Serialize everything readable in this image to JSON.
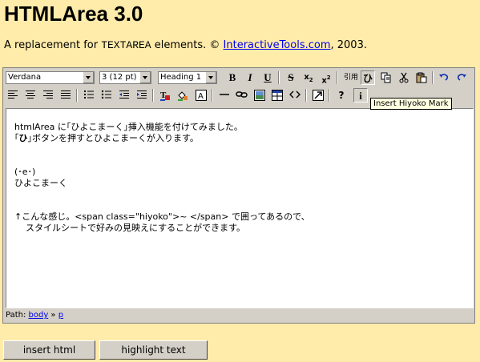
{
  "page": {
    "title": "HTMLArea 3.0",
    "subtitle_prefix": "A replacement for ",
    "subtitle_code": "TEXTAREA",
    "subtitle_middle": " elements. © ",
    "subtitle_link": "InteractiveTools.com",
    "subtitle_suffix": ", 2003."
  },
  "toolbar": {
    "font_name": "Verdana",
    "font_size": "3 (12 pt)",
    "format_block": "Heading 1",
    "bold": "B",
    "italic": "I",
    "underline": "U",
    "strikethrough": "S",
    "subscript": "x",
    "subscript_mark": "2",
    "superscript": "x",
    "superscript_mark": "2",
    "quote_label": "引用",
    "hiyoko_label": "ひ",
    "help_label": "?",
    "about_label": "i",
    "tooltip": "Insert Hiyoko Mark"
  },
  "content": {
    "line1": "htmlArea に｢ひよこまーく｣挿入機能を付けてみました。",
    "line2_open": "｢",
    "line2_bold": "ひ",
    "line2_rest": "｣ボタンを押すとひよこまーくが入ります。",
    "face": "(･e･)",
    "face_caption": "ひよこまーく",
    "note1": "↑こんな感じ。<span class=\"hiyoko\">~ </span> で囲ってあるので、",
    "note2": "スタイルシートで好みの見映えにすることができます。"
  },
  "statusbar": {
    "label": "Path: ",
    "crumb1": "body",
    "separator": " » ",
    "crumb2": "p"
  },
  "buttons": {
    "insert_html": "insert html",
    "highlight_text": "highlight text"
  },
  "colors": {
    "page_background": "#FFEBAA",
    "toolbar": "#D4D0C8",
    "link": "#0000EE"
  }
}
